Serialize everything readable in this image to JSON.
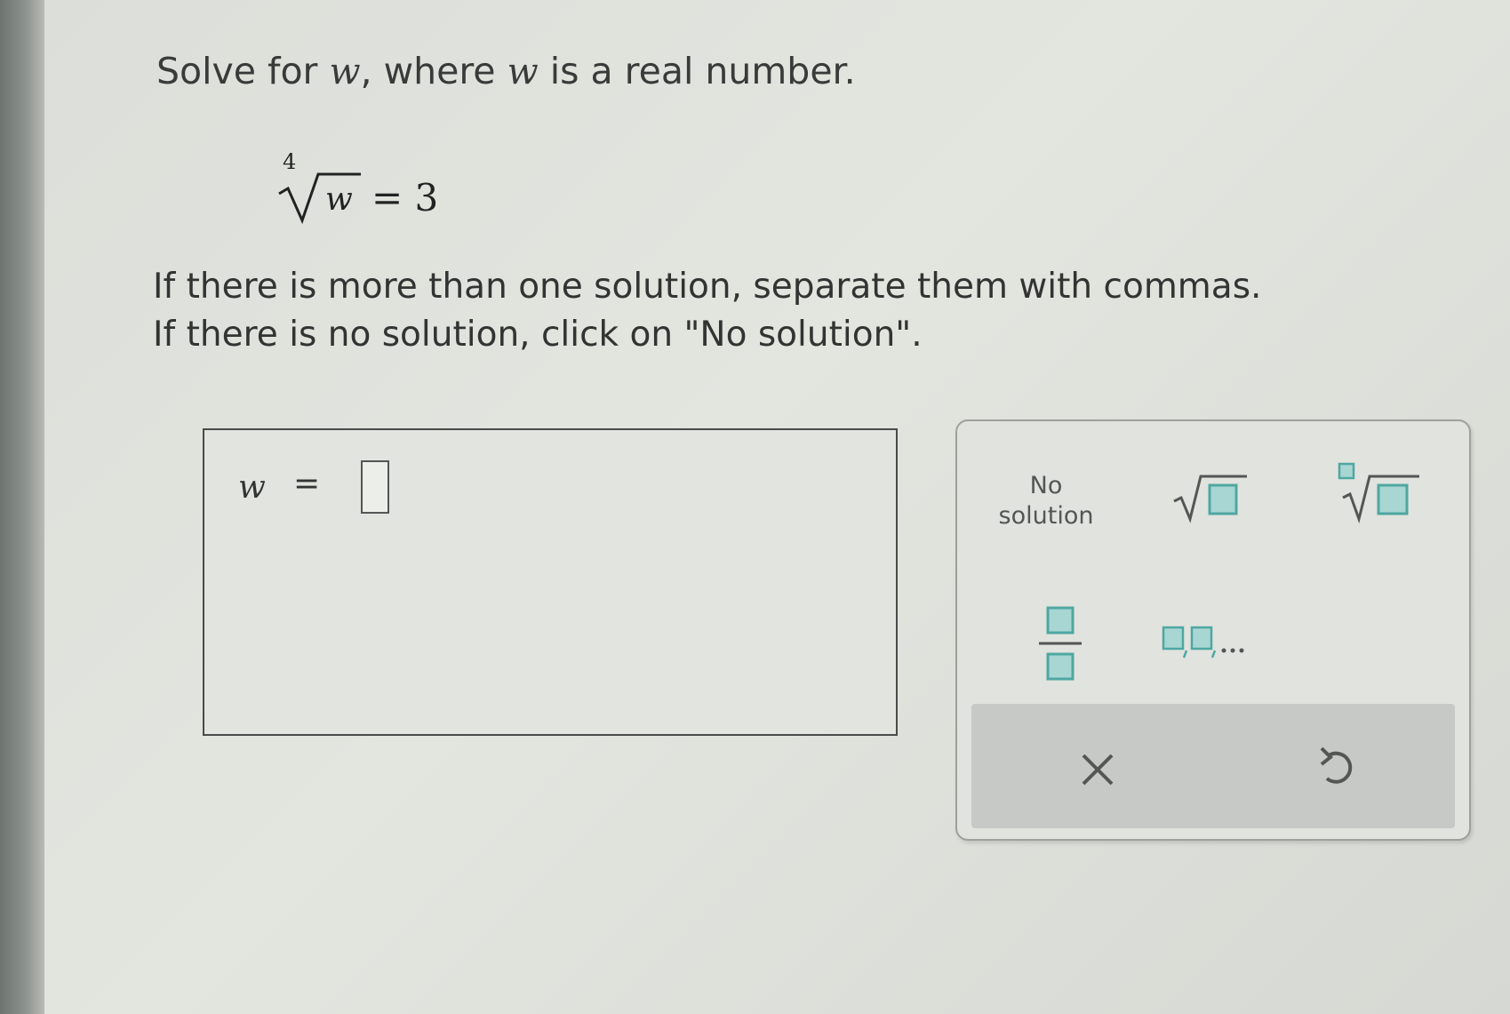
{
  "question": {
    "prompt": {
      "before": "Solve for ",
      "var1": "w",
      "middle": ", where ",
      "var2": "w",
      "after": " is a real number."
    },
    "equation": {
      "root_index": "4",
      "radicand": "w",
      "rhs": "= 3"
    },
    "instructions": [
      "If there is more than one solution, separate them with commas.",
      "If there is no solution, click on \"No solution\"."
    ]
  },
  "answer": {
    "variable": "w",
    "equals": "=",
    "value": ""
  },
  "keypad": {
    "no_solution_line1": "No",
    "no_solution_line2": "solution",
    "keys": [
      "no-solution",
      "square-root",
      "nth-root",
      "fraction",
      "list"
    ],
    "actions": [
      "clear",
      "undo"
    ],
    "icon_color": "#4fa7a2"
  },
  "colors": {
    "background": "#dcdfd9",
    "text": "#333333",
    "accent_teal": "#4fa7a2",
    "action_bar": "#c6c9c5"
  }
}
